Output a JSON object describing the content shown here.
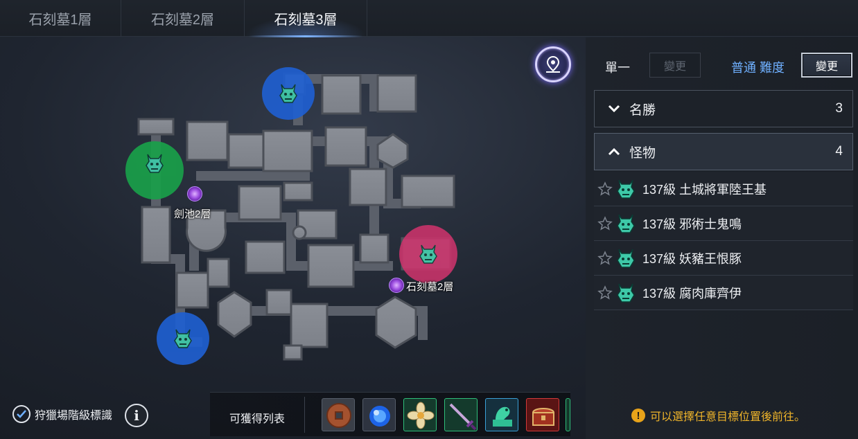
{
  "tabs": [
    {
      "label": "石刻墓1層"
    },
    {
      "label": "石刻墓2層"
    },
    {
      "label": "石刻墓3層"
    }
  ],
  "map": {
    "portals": [
      {
        "label": "劍池2層"
      },
      {
        "label": "石刻墓2層"
      }
    ],
    "zone_colors": {
      "blue": "#1f5fd0",
      "green": "#19a04a",
      "pink": "#c8336a"
    },
    "locate_icon": "map-pin-icon"
  },
  "panel": {
    "single_label": "單一",
    "single_change": "變更",
    "difficulty_label": "普通 難度",
    "difficulty_change": "變更",
    "sections": [
      {
        "title": "名勝",
        "count": "3",
        "expanded": false
      },
      {
        "title": "怪物",
        "count": "4",
        "expanded": true
      }
    ],
    "monsters": [
      {
        "name": "137級 土城將軍陸王基"
      },
      {
        "name": "137級 邪術士鬼鳴"
      },
      {
        "name": "137級 妖豬王恨豚"
      },
      {
        "name": "137級 腐肉庫齊伊"
      }
    ],
    "hint": "可以選擇任意目標位置後前往。",
    "hint_color": "#f0b52a"
  },
  "bottom": {
    "checkbox_label": "狩獵場階級標識",
    "checkbox_checked": true,
    "info_icon": "info-icon",
    "loot_label": "可獲得列表",
    "loot_items": [
      {
        "icon": "coin-icon"
      },
      {
        "icon": "blue-orb-icon"
      },
      {
        "icon": "flower-icon"
      },
      {
        "icon": "sword-icon"
      },
      {
        "icon": "jade-dragon-icon"
      },
      {
        "icon": "treasure-chest-icon"
      }
    ]
  }
}
